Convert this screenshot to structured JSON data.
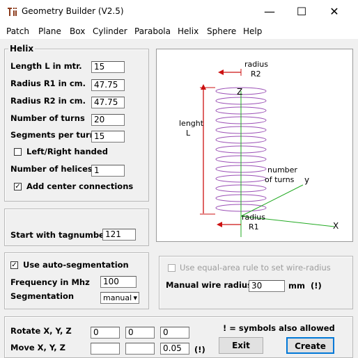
{
  "window": {
    "title": "Geometry Builder (V2.5)",
    "min": "—",
    "max": "☐",
    "close": "✕"
  },
  "menu": [
    "Patch",
    "Plane",
    "Box",
    "Cylinder",
    "Parabola",
    "Helix",
    "Sphere",
    "Help"
  ],
  "helix": {
    "legend": "Helix",
    "length_label": "Length L in mtr.",
    "length_value": "15",
    "r1_label": "Radius R1 in cm.",
    "r1_value": "47.75",
    "r2_label": "Radius R2 in cm.",
    "r2_value": "47.75",
    "turns_label": "Number of turns",
    "turns_value": "20",
    "segments_label": "Segments per turn",
    "segments_value": "15",
    "handed_label": "Left/Right handed",
    "handed_checked": false,
    "helices_label": "Number of helices",
    "helices_value": "1",
    "center_label": "Add center connections",
    "center_checked": true
  },
  "tag": {
    "label": "Start with tagnumber",
    "value": "121"
  },
  "diagram": {
    "radius_top": "radius",
    "r2": "R2",
    "lenght": "lenght",
    "l": "L",
    "z": "Z",
    "y": "y",
    "x": "X",
    "number": "number",
    "of_turns": "of turns",
    "radius_bottom": "radius",
    "r1": "R1"
  },
  "segmentation": {
    "auto_label": "Use auto-segmentation",
    "auto_checked": true,
    "freq_label": "Frequency in Mhz",
    "freq_value": "100",
    "seg_label": "Segmentation",
    "seg_value": "manual"
  },
  "wire": {
    "equal_label": "Use equal-area rule to set wire-radius",
    "equal_checked": false,
    "manual_label": "Manual wire radius",
    "manual_value": "30",
    "unit": "mm",
    "excl": "(!)"
  },
  "transform": {
    "rotate_label": "Rotate X, Y, Z",
    "rotate_x": "0",
    "rotate_y": "0",
    "rotate_z": "0",
    "move_label": "Move X, Y, Z",
    "move_x": "",
    "move_y": "",
    "move_z": "0.05",
    "move_excl": "(!)",
    "note": "! =  symbols also allowed",
    "exit": "Exit",
    "create": "Create"
  },
  "colors": {
    "accent": "#0078d7",
    "red": "#cc1111",
    "helix": "#9a4fb5",
    "green": "#22aa22"
  }
}
